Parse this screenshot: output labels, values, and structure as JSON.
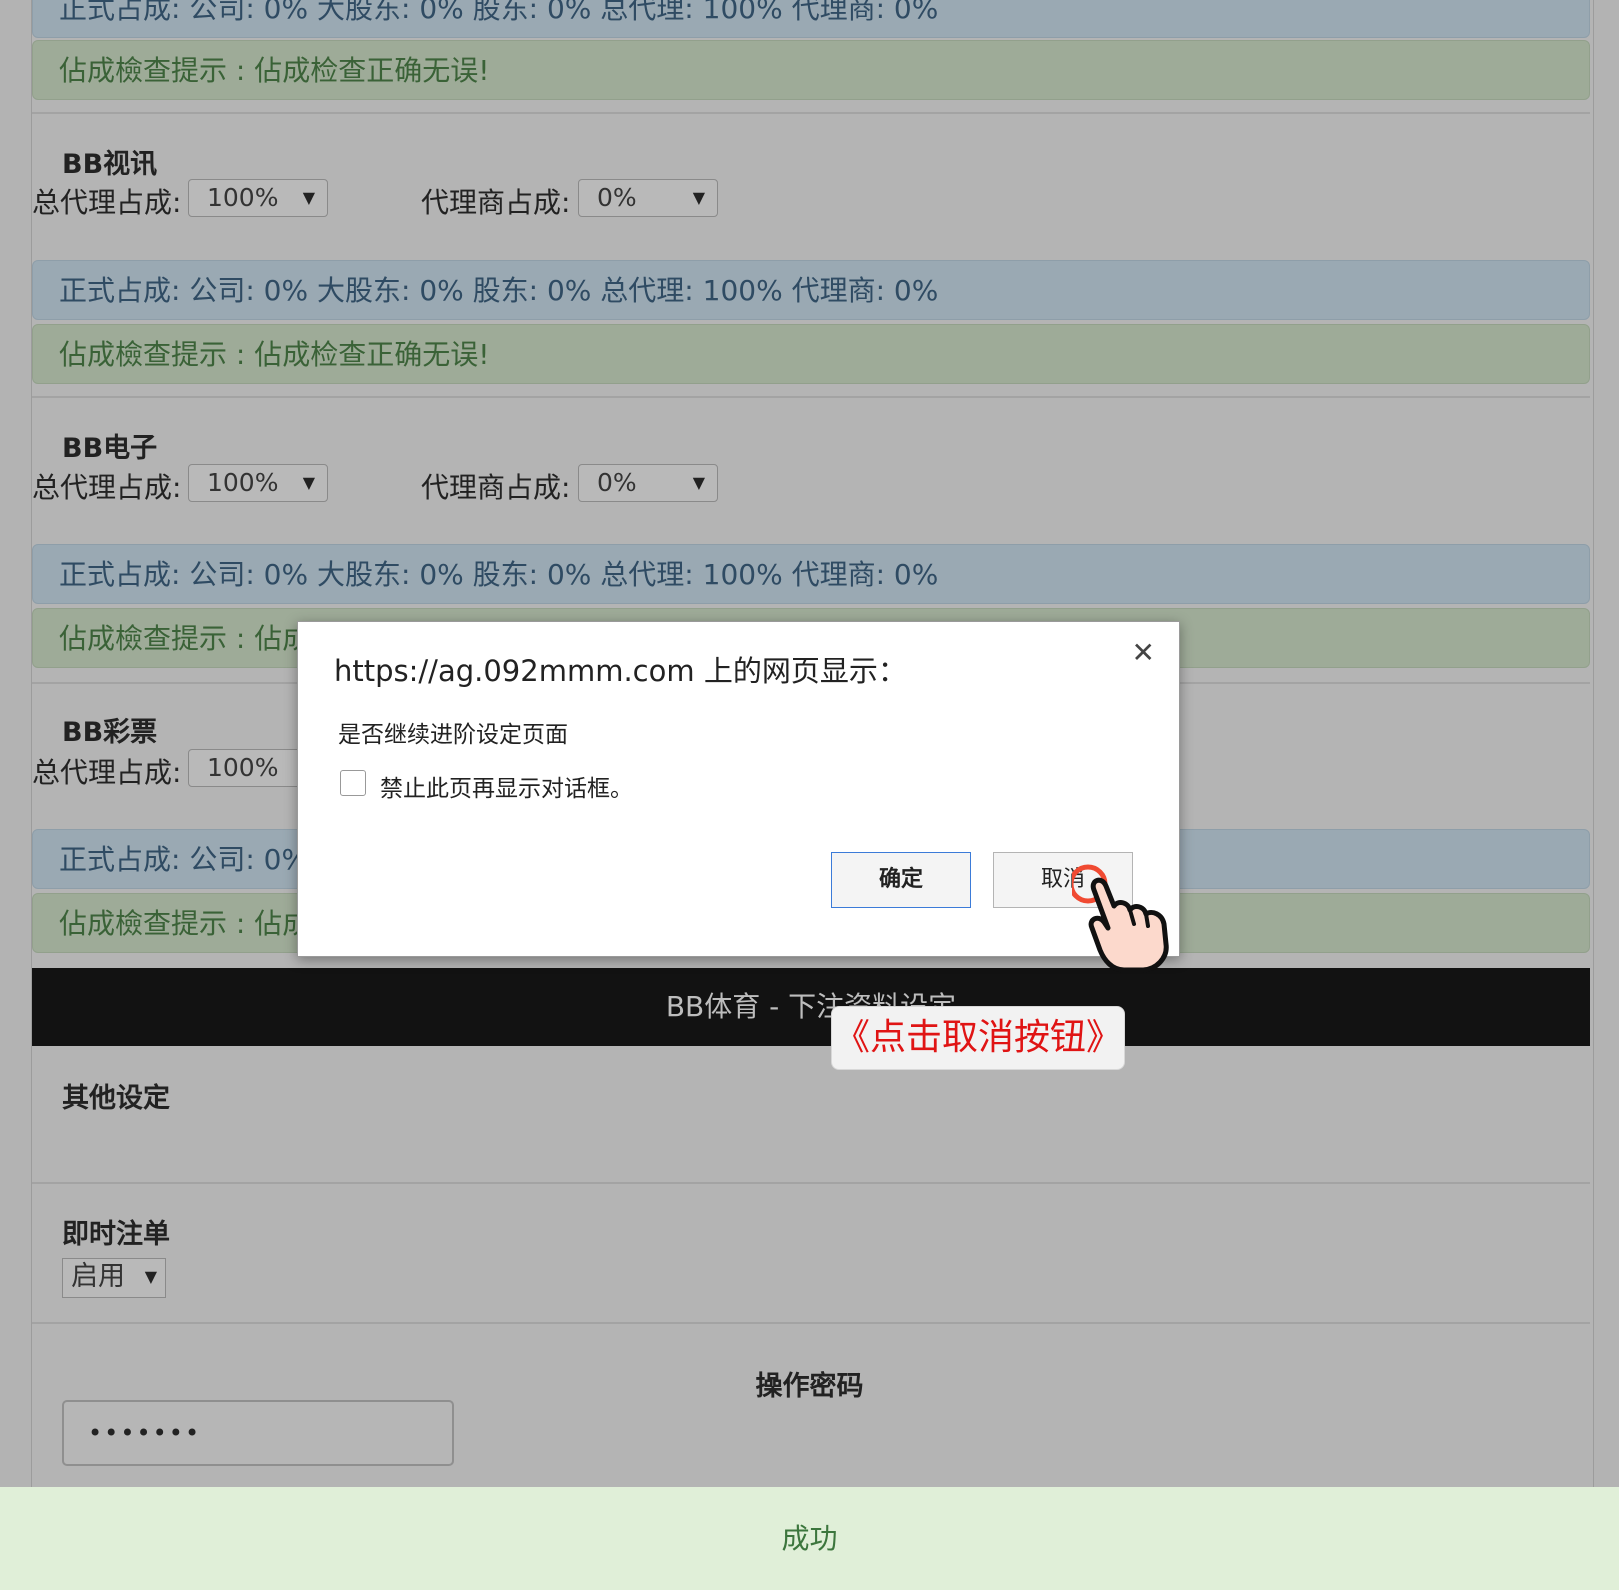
{
  "sections": [
    {
      "title": "BB视讯",
      "total_agent_label": "总代理占成:",
      "total_agent_value": "100%",
      "agent_label": "代理商占成:",
      "agent_value": "0%"
    },
    {
      "title": "BB电子",
      "total_agent_label": "总代理占成:",
      "total_agent_value": "100%",
      "agent_label": "代理商占成:",
      "agent_value": "0%"
    },
    {
      "title": "BB彩票",
      "total_agent_label": "总代理占成:",
      "total_agent_value": "100%"
    }
  ],
  "formal_share_text": "正式占成: 公司: 0% 大股东: 0% 股东: 0% 总代理: 100% 代理商: 0%",
  "formal_share_partial": "正式占成: 公司: 0%",
  "check_tip_text": "佔成檢查提示 : 佔成检查正确无误!",
  "check_tip_partial": "佔成檢查提示 : 佔成",
  "sports_bar_title": "BB体育 - 下注资料设定",
  "other_settings_title": "其他设定",
  "instant_bet": {
    "title": "即时注单",
    "value": "启用"
  },
  "password": {
    "title": "操作密码",
    "masked_value": "•••••••"
  },
  "success_text": "成功",
  "dialog": {
    "title": "https://ag.092mmm.com 上的网页显示：",
    "message": "是否继续进阶设定页面",
    "checkbox_label": "禁止此页再显示对话框。",
    "ok_label": "确定",
    "cancel_label": "取消"
  },
  "callout_text": "《点击取消按钮》",
  "icons": {
    "close": "close-icon",
    "arrow": "dropdown-arrow-icon",
    "hand": "pointing-hand-icon"
  },
  "colors": {
    "info_bg": "#9aa9b3",
    "ok_bg": "#9eab98",
    "success_bg": "#e0efd8",
    "callout_text": "#e01414",
    "ok_border": "#3b7bd8"
  }
}
